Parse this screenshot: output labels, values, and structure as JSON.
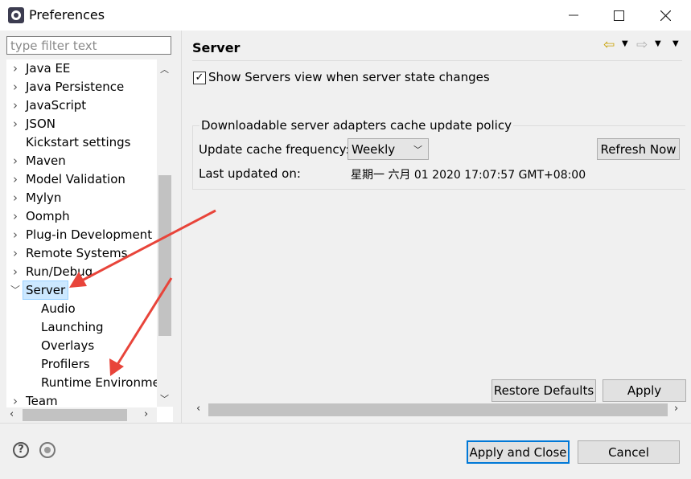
{
  "window": {
    "title": "Preferences",
    "minimize_icon": "minimize-icon",
    "maximize_icon": "maximize-icon",
    "close_icon": "close-icon"
  },
  "sidebar": {
    "filter_placeholder": "type filter text",
    "items": [
      {
        "label": "Java EE",
        "expander": "collapsed"
      },
      {
        "label": "Java Persistence",
        "expander": "collapsed"
      },
      {
        "label": "JavaScript",
        "expander": "collapsed"
      },
      {
        "label": "JSON",
        "expander": "collapsed"
      },
      {
        "label": "Kickstart settings",
        "expander": "none"
      },
      {
        "label": "Maven",
        "expander": "collapsed"
      },
      {
        "label": "Model Validation",
        "expander": "collapsed"
      },
      {
        "label": "Mylyn",
        "expander": "collapsed"
      },
      {
        "label": "Oomph",
        "expander": "collapsed"
      },
      {
        "label": "Plug-in Development",
        "expander": "collapsed"
      },
      {
        "label": "Remote Systems",
        "expander": "collapsed"
      },
      {
        "label": "Run/Debug",
        "expander": "collapsed"
      },
      {
        "label": "Server",
        "expander": "expanded",
        "selected": true
      },
      {
        "label": "Audio",
        "expander": "child"
      },
      {
        "label": "Launching",
        "expander": "child"
      },
      {
        "label": "Overlays",
        "expander": "child"
      },
      {
        "label": "Profilers",
        "expander": "child"
      },
      {
        "label": "Runtime Environme",
        "expander": "child"
      },
      {
        "label": "Team",
        "expander": "collapsed"
      }
    ]
  },
  "page": {
    "title": "Server",
    "show_servers_checked": true,
    "show_servers_label": "Show Servers view when server state changes",
    "group_title": "Downloadable server adapters cache update policy",
    "update_freq_label": "Update cache frequency:",
    "update_freq_value": "Weekly",
    "refresh_label": "Refresh Now",
    "last_updated_label": "Last updated on:",
    "last_updated_value": "星期一 六月 01 2020 17:07:57 GMT+08:00",
    "restore_defaults_label": "Restore Defaults",
    "apply_label": "Apply"
  },
  "footer": {
    "apply_close_label": "Apply and Close",
    "cancel_label": "Cancel",
    "help_icon": "help-icon",
    "record_icon": "record-icon"
  },
  "colors": {
    "selection_bg": "#cce8ff",
    "default_button_border": "#0078d7",
    "annotation_arrow": "#e8443a",
    "nav_back": "#c8a000"
  }
}
